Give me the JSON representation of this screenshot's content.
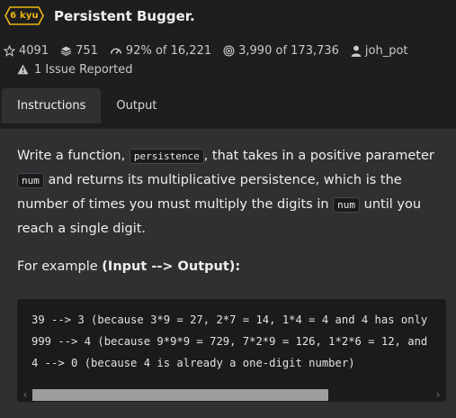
{
  "kata": {
    "rank": "6 kyu",
    "title": "Persistent Bugger.",
    "stats": {
      "stars": "4091",
      "collections": "751",
      "satisfaction": "92%",
      "satisfaction_of": "of 16,221",
      "completions": "3,990",
      "completions_of": "of 173,736",
      "author": "joh_pot"
    },
    "issues": "1 Issue Reported"
  },
  "tabs": [
    {
      "label": "Instructions",
      "active": true
    },
    {
      "label": "Output",
      "active": false
    }
  ],
  "description": {
    "p1": "Write a function, ",
    "code1": "persistence",
    "p2": ", that takes in a positive parameter ",
    "code2": "num",
    "p3": " and returns its multiplicative persistence, which is the number of times you must multiply the digits in ",
    "code3": "num",
    "p4": " until you reach a single digit.",
    "example_prefix": "For example ",
    "example_bold": "(Input --> Output):"
  },
  "code_example": {
    "lines": [
      "39 --> 3 (because 3*9 = 27, 2*7 = 14, 1*4 = 4 and 4 has only",
      "999 --> 4 (because 9*9*9 = 729, 7*2*9 = 126, 1*2*6 = 12, and",
      "4 --> 0 (because 4 is already a one-digit number)"
    ]
  },
  "icons": {
    "rank": "hexagon-badge",
    "stars": "star-icon",
    "collections": "stack-icon",
    "satisfaction": "gauge-icon",
    "completions": "target-icon",
    "author": "user-icon",
    "issues": "warning-icon"
  },
  "colors": {
    "background": "#1e1e20",
    "panel": "#303033",
    "rank": "#ecb613",
    "code_bg": "#1b1b1d"
  }
}
